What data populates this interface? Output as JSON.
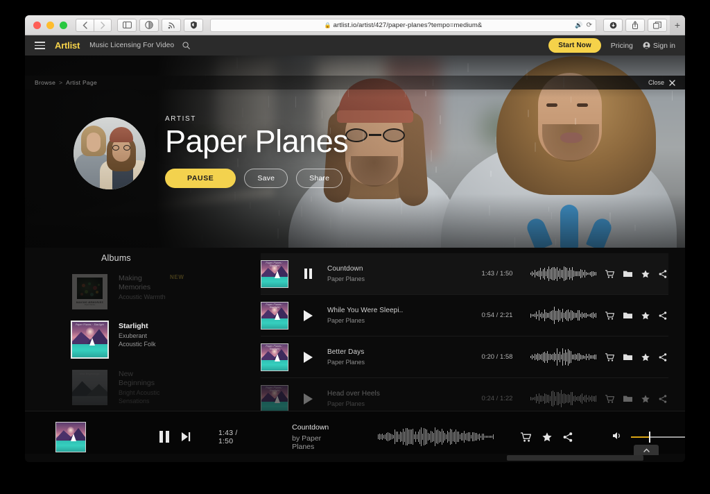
{
  "browser": {
    "url": "artlist.io/artist/427/paper-planes?tempo=medium&",
    "lock_icon": "lock-icon",
    "back_icon": "chevron-left-icon",
    "forward_icon": "chevron-right-icon",
    "sidebar_icon": "sidebar-icon",
    "reader_icon": "reader-icon",
    "rss_icon": "rss-icon",
    "shield_icon": "shield-icon",
    "mute_icon": "speaker-icon",
    "reload_icon": "reload-icon",
    "download_icon": "download-icon",
    "share_icon": "share-icon",
    "tabs_icon": "tabs-icon",
    "new_tab_label": "+"
  },
  "nav": {
    "menu_icon": "hamburger-icon",
    "logo": "Artlist",
    "tagline": "Music Licensing For Video",
    "search_icon": "search-icon",
    "start_now": "Start Now",
    "pricing": "Pricing",
    "sign_in": "Sign in",
    "accent_yellow": "#f5d24a"
  },
  "breadcrumb": {
    "root": "Browse",
    "separator": ">",
    "current": "Artist Page",
    "close_label": "Close",
    "close_icon": "close-icon"
  },
  "hero": {
    "kicker": "ARTIST",
    "name": "Paper Planes",
    "pause_label": "PAUSE",
    "save_label": "Save",
    "share_label": "Share"
  },
  "albums": {
    "title": "Albums",
    "items": [
      {
        "name": "Making Memories",
        "tags": "Acoustic Warmth",
        "badge": "NEW",
        "selected": false,
        "art": "memories"
      },
      {
        "name": "Starlight",
        "tags": "Exuberant Acoustic Folk",
        "badge": "",
        "selected": true,
        "art": "starlight"
      },
      {
        "name": "New Beginnings",
        "tags": "Bright Acoustic Sensations",
        "badge": "",
        "selected": false,
        "art": "beginnings"
      }
    ]
  },
  "tracks": [
    {
      "title": "Countdown",
      "artist": "Paper Planes",
      "elapsed": "1:43",
      "duration": "1:50",
      "time": "1:43 / 1:50",
      "playing": true
    },
    {
      "title": "While You Were Sleepi..",
      "artist": "Paper Planes",
      "elapsed": "0:54",
      "duration": "2:21",
      "time": "0:54 / 2:21",
      "playing": false
    },
    {
      "title": "Better Days",
      "artist": "Paper Planes",
      "elapsed": "0:20",
      "duration": "1:58",
      "time": "0:20 / 1:58",
      "playing": false
    },
    {
      "title": "Head over Heels",
      "artist": "Paper Planes",
      "elapsed": "0:24",
      "duration": "1:22",
      "time": "0:24 / 1:22",
      "playing": false
    }
  ],
  "track_actions": {
    "cart_icon": "cart-icon",
    "folder_icon": "folder-icon",
    "star_icon": "star-icon",
    "share_icon": "share-icon"
  },
  "player": {
    "pause_icon": "pause-icon",
    "next_icon": "next-track-icon",
    "time": "1:43 / 1:50",
    "title": "Countdown",
    "by": "by Paper Planes",
    "cart_icon": "cart-icon",
    "star_icon": "star-icon",
    "share_icon": "share-icon",
    "volume_icon": "volume-icon",
    "volume_percent": 33,
    "volume_fill_color": "#d9a514"
  },
  "scrollbar": {
    "collapse_icon": "chevron-up-icon"
  }
}
